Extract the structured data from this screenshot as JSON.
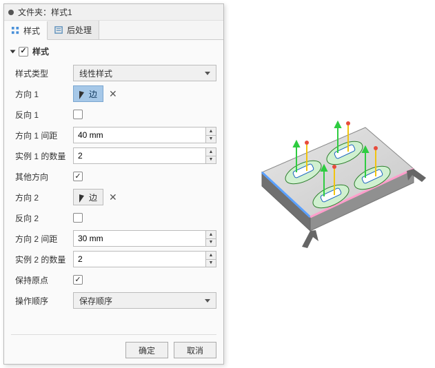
{
  "title": "文件夹：样式1",
  "tabs": {
    "style": "样式",
    "post": "后处理"
  },
  "section": {
    "header": "样式"
  },
  "fields": {
    "patternTypeLabel": "样式类型",
    "patternTypeValue": "线性样式",
    "dir1Label": "方向 1",
    "edgeBtn": "边",
    "reverse1Label": "反向 1",
    "spacing1Label": "方向 1 间距",
    "spacing1Value": "40 mm",
    "count1Label": "实例 1 的数量",
    "count1Value": "2",
    "otherDirLabel": "其他方向",
    "dir2Label": "方向 2",
    "reverse2Label": "反向 2",
    "spacing2Label": "方向 2 间距",
    "spacing2Value": "30 mm",
    "count2Label": "实例 2 的数量",
    "count2Value": "2",
    "keepOriginLabel": "保持原点",
    "orderLabel": "操作顺序",
    "orderValue": "保存顺序"
  },
  "buttons": {
    "ok": "确定",
    "cancel": "取消"
  }
}
